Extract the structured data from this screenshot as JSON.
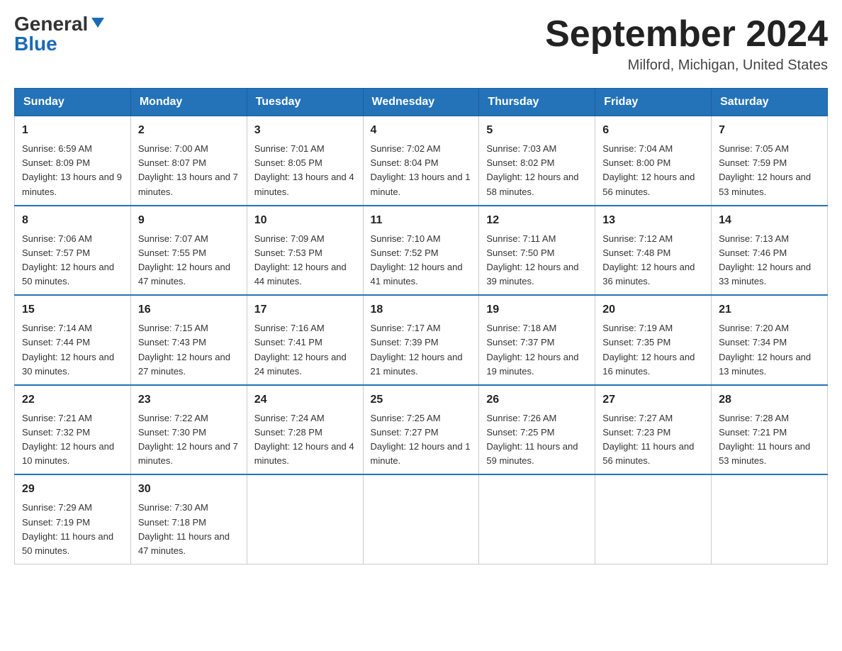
{
  "logo": {
    "general": "General",
    "blue": "Blue"
  },
  "header": {
    "month_year": "September 2024",
    "location": "Milford, Michigan, United States"
  },
  "days_of_week": [
    "Sunday",
    "Monday",
    "Tuesday",
    "Wednesday",
    "Thursday",
    "Friday",
    "Saturday"
  ],
  "weeks": [
    [
      {
        "day": "1",
        "sunrise": "Sunrise: 6:59 AM",
        "sunset": "Sunset: 8:09 PM",
        "daylight": "Daylight: 13 hours and 9 minutes."
      },
      {
        "day": "2",
        "sunrise": "Sunrise: 7:00 AM",
        "sunset": "Sunset: 8:07 PM",
        "daylight": "Daylight: 13 hours and 7 minutes."
      },
      {
        "day": "3",
        "sunrise": "Sunrise: 7:01 AM",
        "sunset": "Sunset: 8:05 PM",
        "daylight": "Daylight: 13 hours and 4 minutes."
      },
      {
        "day": "4",
        "sunrise": "Sunrise: 7:02 AM",
        "sunset": "Sunset: 8:04 PM",
        "daylight": "Daylight: 13 hours and 1 minute."
      },
      {
        "day": "5",
        "sunrise": "Sunrise: 7:03 AM",
        "sunset": "Sunset: 8:02 PM",
        "daylight": "Daylight: 12 hours and 58 minutes."
      },
      {
        "day": "6",
        "sunrise": "Sunrise: 7:04 AM",
        "sunset": "Sunset: 8:00 PM",
        "daylight": "Daylight: 12 hours and 56 minutes."
      },
      {
        "day": "7",
        "sunrise": "Sunrise: 7:05 AM",
        "sunset": "Sunset: 7:59 PM",
        "daylight": "Daylight: 12 hours and 53 minutes."
      }
    ],
    [
      {
        "day": "8",
        "sunrise": "Sunrise: 7:06 AM",
        "sunset": "Sunset: 7:57 PM",
        "daylight": "Daylight: 12 hours and 50 minutes."
      },
      {
        "day": "9",
        "sunrise": "Sunrise: 7:07 AM",
        "sunset": "Sunset: 7:55 PM",
        "daylight": "Daylight: 12 hours and 47 minutes."
      },
      {
        "day": "10",
        "sunrise": "Sunrise: 7:09 AM",
        "sunset": "Sunset: 7:53 PM",
        "daylight": "Daylight: 12 hours and 44 minutes."
      },
      {
        "day": "11",
        "sunrise": "Sunrise: 7:10 AM",
        "sunset": "Sunset: 7:52 PM",
        "daylight": "Daylight: 12 hours and 41 minutes."
      },
      {
        "day": "12",
        "sunrise": "Sunrise: 7:11 AM",
        "sunset": "Sunset: 7:50 PM",
        "daylight": "Daylight: 12 hours and 39 minutes."
      },
      {
        "day": "13",
        "sunrise": "Sunrise: 7:12 AM",
        "sunset": "Sunset: 7:48 PM",
        "daylight": "Daylight: 12 hours and 36 minutes."
      },
      {
        "day": "14",
        "sunrise": "Sunrise: 7:13 AM",
        "sunset": "Sunset: 7:46 PM",
        "daylight": "Daylight: 12 hours and 33 minutes."
      }
    ],
    [
      {
        "day": "15",
        "sunrise": "Sunrise: 7:14 AM",
        "sunset": "Sunset: 7:44 PM",
        "daylight": "Daylight: 12 hours and 30 minutes."
      },
      {
        "day": "16",
        "sunrise": "Sunrise: 7:15 AM",
        "sunset": "Sunset: 7:43 PM",
        "daylight": "Daylight: 12 hours and 27 minutes."
      },
      {
        "day": "17",
        "sunrise": "Sunrise: 7:16 AM",
        "sunset": "Sunset: 7:41 PM",
        "daylight": "Daylight: 12 hours and 24 minutes."
      },
      {
        "day": "18",
        "sunrise": "Sunrise: 7:17 AM",
        "sunset": "Sunset: 7:39 PM",
        "daylight": "Daylight: 12 hours and 21 minutes."
      },
      {
        "day": "19",
        "sunrise": "Sunrise: 7:18 AM",
        "sunset": "Sunset: 7:37 PM",
        "daylight": "Daylight: 12 hours and 19 minutes."
      },
      {
        "day": "20",
        "sunrise": "Sunrise: 7:19 AM",
        "sunset": "Sunset: 7:35 PM",
        "daylight": "Daylight: 12 hours and 16 minutes."
      },
      {
        "day": "21",
        "sunrise": "Sunrise: 7:20 AM",
        "sunset": "Sunset: 7:34 PM",
        "daylight": "Daylight: 12 hours and 13 minutes."
      }
    ],
    [
      {
        "day": "22",
        "sunrise": "Sunrise: 7:21 AM",
        "sunset": "Sunset: 7:32 PM",
        "daylight": "Daylight: 12 hours and 10 minutes."
      },
      {
        "day": "23",
        "sunrise": "Sunrise: 7:22 AM",
        "sunset": "Sunset: 7:30 PM",
        "daylight": "Daylight: 12 hours and 7 minutes."
      },
      {
        "day": "24",
        "sunrise": "Sunrise: 7:24 AM",
        "sunset": "Sunset: 7:28 PM",
        "daylight": "Daylight: 12 hours and 4 minutes."
      },
      {
        "day": "25",
        "sunrise": "Sunrise: 7:25 AM",
        "sunset": "Sunset: 7:27 PM",
        "daylight": "Daylight: 12 hours and 1 minute."
      },
      {
        "day": "26",
        "sunrise": "Sunrise: 7:26 AM",
        "sunset": "Sunset: 7:25 PM",
        "daylight": "Daylight: 11 hours and 59 minutes."
      },
      {
        "day": "27",
        "sunrise": "Sunrise: 7:27 AM",
        "sunset": "Sunset: 7:23 PM",
        "daylight": "Daylight: 11 hours and 56 minutes."
      },
      {
        "day": "28",
        "sunrise": "Sunrise: 7:28 AM",
        "sunset": "Sunset: 7:21 PM",
        "daylight": "Daylight: 11 hours and 53 minutes."
      }
    ],
    [
      {
        "day": "29",
        "sunrise": "Sunrise: 7:29 AM",
        "sunset": "Sunset: 7:19 PM",
        "daylight": "Daylight: 11 hours and 50 minutes."
      },
      {
        "day": "30",
        "sunrise": "Sunrise: 7:30 AM",
        "sunset": "Sunset: 7:18 PM",
        "daylight": "Daylight: 11 hours and 47 minutes."
      },
      null,
      null,
      null,
      null,
      null
    ]
  ]
}
